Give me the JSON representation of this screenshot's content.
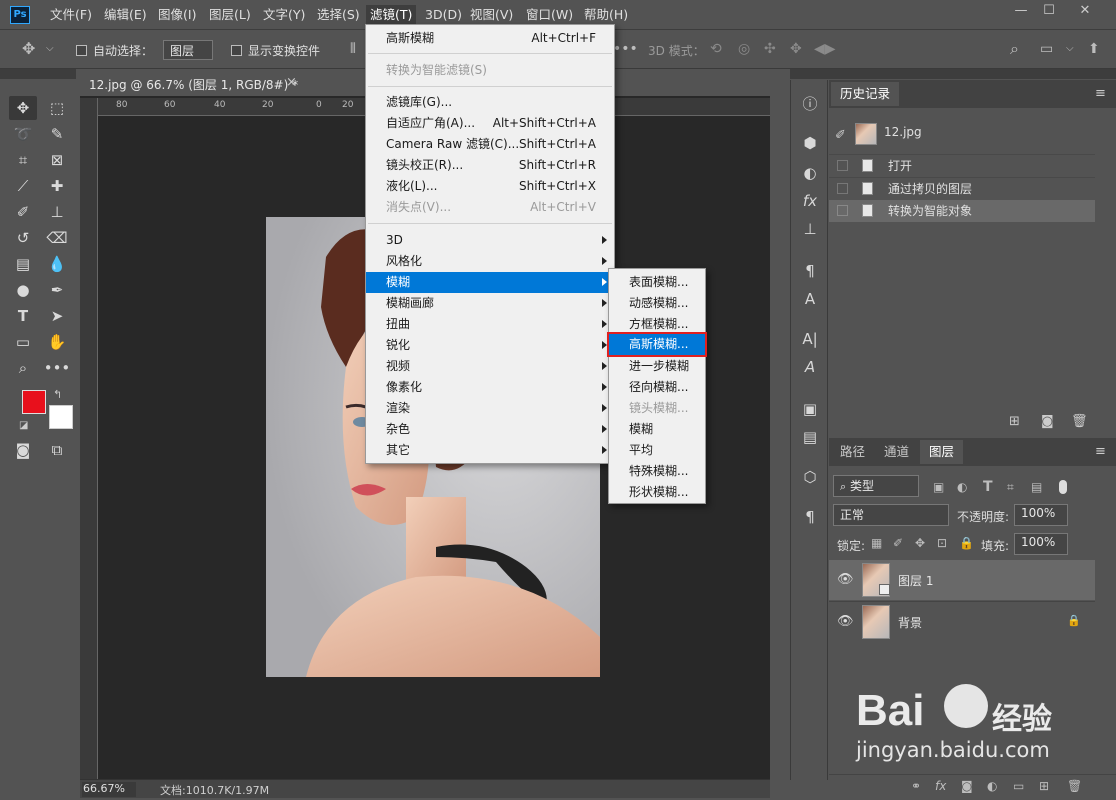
{
  "app": {
    "logo": "Ps"
  },
  "menubar": {
    "items": [
      "文件(F)",
      "编辑(E)",
      "图像(I)",
      "图层(L)",
      "文字(Y)",
      "选择(S)",
      "滤镜(T)",
      "3D(D)",
      "视图(V)",
      "窗口(W)",
      "帮助(H)"
    ],
    "active": "滤镜(T)"
  },
  "window_controls": {
    "minimize": "—",
    "maximize": "☐",
    "close": "✕"
  },
  "options_bar": {
    "auto_select_label": "自动选择：",
    "auto_select_value": "图层",
    "show_transform_label": "显示变换控件",
    "mode_3d_label": "3D 模式："
  },
  "document": {
    "tab_title": "12.jpg @ 66.7% (图层 1, RGB/8#) *",
    "tab_close": "×",
    "ruler_ticks": [
      "80",
      "60",
      "40",
      "20",
      "0",
      "20"
    ],
    "zoom": "66.67%",
    "doc_info": "文档:1010.7K/1.97M"
  },
  "filter_menu": {
    "items": [
      {
        "label": "高斯模糊",
        "shortcut": "Alt+Ctrl+F",
        "disabled": false
      },
      {
        "label": "转换为智能滤镜(S)",
        "shortcut": "",
        "disabled": true
      },
      {
        "label": "滤镜库(G)...",
        "shortcut": "",
        "disabled": false
      },
      {
        "label": "自适应广角(A)...",
        "shortcut": "Alt+Shift+Ctrl+A",
        "disabled": false
      },
      {
        "label": "Camera Raw 滤镜(C)...",
        "shortcut": "Shift+Ctrl+A",
        "disabled": false
      },
      {
        "label": "镜头校正(R)...",
        "shortcut": "Shift+Ctrl+R",
        "disabled": false
      },
      {
        "label": "液化(L)...",
        "shortcut": "Shift+Ctrl+X",
        "disabled": false
      },
      {
        "label": "消失点(V)...",
        "shortcut": "Alt+Ctrl+V",
        "disabled": true
      },
      {
        "label": "3D"
      },
      {
        "label": "风格化"
      },
      {
        "label": "模糊"
      },
      {
        "label": "模糊画廊"
      },
      {
        "label": "扭曲"
      },
      {
        "label": "锐化"
      },
      {
        "label": "视频"
      },
      {
        "label": "像素化"
      },
      {
        "label": "渲染"
      },
      {
        "label": "杂色"
      },
      {
        "label": "其它"
      }
    ],
    "highlighted": "模糊"
  },
  "blur_submenu": {
    "items": [
      "表面模糊...",
      "动感模糊...",
      "方框模糊...",
      "高斯模糊...",
      "进一步模糊",
      "径向模糊...",
      "镜头模糊...",
      "模糊",
      "平均",
      "特殊模糊...",
      "形状模糊..."
    ],
    "highlighted": "高斯模糊...",
    "disabled": [
      "镜头模糊..."
    ]
  },
  "history_panel": {
    "tab": "历史记录",
    "snapshot": "12.jpg",
    "states": [
      "打开",
      "通过拷贝的图层",
      "转换为智能对象"
    ],
    "active_state": "转换为智能对象"
  },
  "layers_panel": {
    "tabs": [
      "路径",
      "通道",
      "图层"
    ],
    "active_tab": "图层",
    "filter_kind": "类型",
    "blend_mode": "正常",
    "opacity_label": "不透明度:",
    "opacity_value": "100%",
    "lock_label": "锁定:",
    "fill_label": "填充:",
    "fill_value": "100%",
    "layers": [
      {
        "name": "图层 1",
        "selected": true,
        "smart_object": true
      },
      {
        "name": "背景",
        "selected": false,
        "locked": true
      }
    ]
  },
  "colors": {
    "foreground": "#e8101c",
    "background": "#ffffff",
    "highlight": "#0078d7",
    "annotation": "#e02020"
  },
  "watermark": {
    "brand": "Bai",
    "brand2": "经验",
    "url": "jingyan.baidu.com"
  }
}
